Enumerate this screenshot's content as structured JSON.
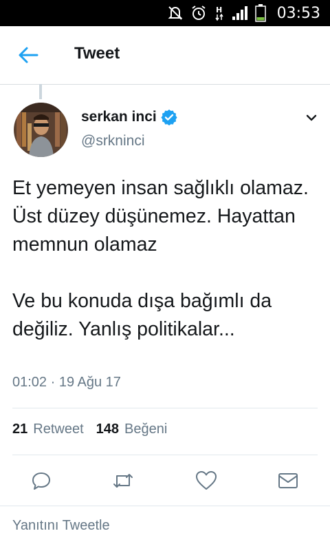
{
  "status_bar": {
    "time": "03:53",
    "icons": [
      "mute-icon",
      "alarm-icon",
      "data-h-icon",
      "signal-icon",
      "battery-icon"
    ]
  },
  "header": {
    "title": "Tweet",
    "back_icon": "arrow-left-icon"
  },
  "tweet": {
    "author_name": "serkan inci",
    "verified_icon": "verified-badge-icon",
    "handle": "@srkninci",
    "menu_icon": "chevron-down-icon",
    "text": "Et yemeyen insan sağlıklı olamaz. Üst düzey düşünemez. Hayattan memnun olamaz\n\nVe bu konuda dışa bağımlı da değiliz. Yanlış politikalar...",
    "timestamp": "01:02 · 19 Ağu 17",
    "retweet_count": "21",
    "retweet_label": "Retweet",
    "like_count": "148",
    "like_label": "Beğeni"
  },
  "actions": [
    "reply-icon",
    "retweet-icon",
    "like-icon",
    "direct-message-icon"
  ],
  "reply_prompt": "Yanıtını Tweetle",
  "colors": {
    "accent": "#1da1f2",
    "text": "#14171a",
    "secondary": "#657786",
    "divider": "#e1e8ed"
  }
}
